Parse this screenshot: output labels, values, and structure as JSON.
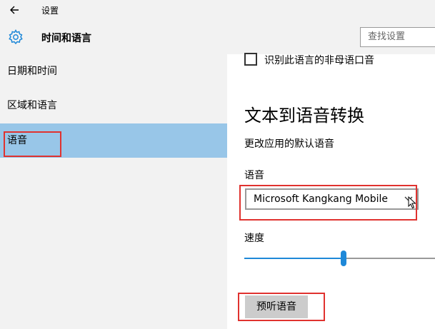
{
  "titlebar": {
    "title": "设置",
    "back_icon": "back-arrow-icon"
  },
  "header": {
    "page_title": "时间和语言",
    "search_placeholder": "查找设置",
    "icon": "gear-icon"
  },
  "sidebar": {
    "items": [
      {
        "label": "日期和时间",
        "selected": false
      },
      {
        "label": "区域和语言",
        "selected": false
      },
      {
        "label": "语音",
        "selected": true
      }
    ]
  },
  "content": {
    "checkbox_label": "识别此语言的非母语口音",
    "heading": "文本到语音转换",
    "subtext": "更改应用的默认语音",
    "voice_label": "语音",
    "voice_value": "Microsoft Kangkang Mobile",
    "speed_label": "速度",
    "speed_value": 0.52,
    "preview_button": "预听语音"
  },
  "colors": {
    "selected": "#98c6e8",
    "accent": "#1e88d8",
    "highlight": "#e0322f"
  }
}
